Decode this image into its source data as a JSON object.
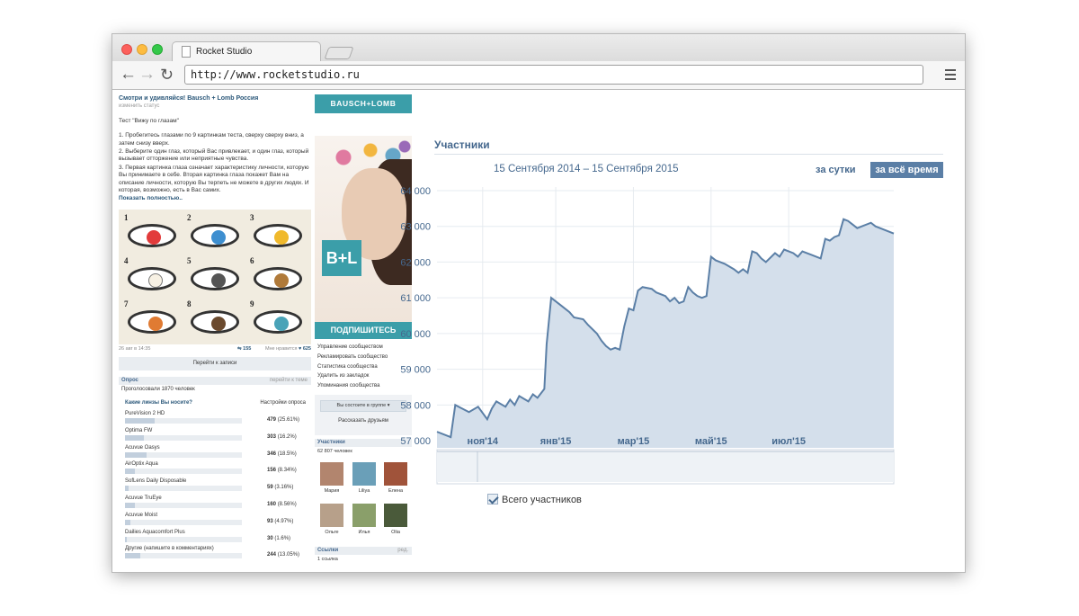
{
  "browser": {
    "tab_title": "Rocket Studio",
    "url": "http://www.rocketstudio.ru"
  },
  "post": {
    "title": "Смотри и удивляйся! Bausch + Lomb Россия",
    "status_link": "изменить статус",
    "lines": [
      "Тест \"Вижу по глазам\"",
      "",
      "1. Пробегитесь глазами по 9 картинкам теста, сверху сверху вниз, а затем снизу вверх.",
      "2. Выберите один глаз, который Вас привлекает, и один глаз, который вызывает отторжение или неприятные чувства.",
      "3. Первая картинка глаза означает характеристику личности, которую Вы принимаете в себе. Вторая картинка глаза покажет Вам на описание личности, которую Вы терпеть не можете в других людях. И которая, возможно, есть в Вас самих."
    ],
    "show_full": "Показать полностью..",
    "eye_numbers": [
      "1",
      "2",
      "3",
      "4",
      "5",
      "6",
      "7",
      "8",
      "9"
    ],
    "date": "26 авг в 14:35",
    "shares": "155",
    "likes_label": "Мне нравится",
    "likes": "625",
    "goto_label": "Перейти к записи"
  },
  "poll": {
    "header": "Опрос",
    "header_link": "перейти к теме",
    "voted": "Проголосовали 1870 человек",
    "question": "Какие линзы Вы носите?",
    "settings": "Настройки опроса",
    "options": [
      {
        "name": "PureVision 2 HD",
        "count": "479",
        "pct": "(25.61%)",
        "frac": 0.2561
      },
      {
        "name": "Optima FW",
        "count": "303",
        "pct": "(16.2%)",
        "frac": 0.162
      },
      {
        "name": "Acuvue Oasys",
        "count": "346",
        "pct": "(18.5%)",
        "frac": 0.185
      },
      {
        "name": "AirOptix Aqua",
        "count": "156",
        "pct": "(8.34%)",
        "frac": 0.0834
      },
      {
        "name": "SofLens Daily Disposable",
        "count": "59",
        "pct": "(3.16%)",
        "frac": 0.0316
      },
      {
        "name": "Acuvue TruEye",
        "count": "160",
        "pct": "(8.56%)",
        "frac": 0.0856
      },
      {
        "name": "Acuvue Moist",
        "count": "93",
        "pct": "(4.97%)",
        "frac": 0.0497
      },
      {
        "name": "Dailies Aquacomfort Plus",
        "count": "30",
        "pct": "(1.6%)",
        "frac": 0.016
      },
      {
        "name": "Другие (напишите в комментариях)",
        "count": "244",
        "pct": "(13.05%)",
        "frac": 0.1305
      }
    ]
  },
  "ad": {
    "brand": "BAUSCH+LOMB",
    "logo": "B+L",
    "subscribe": "ПОДПИШИТЕСЬ"
  },
  "management": [
    "Управление сообществом",
    "Рекламировать сообщество",
    "Статистика сообщества",
    "Удалить из закладок",
    "Упоминания сообщества"
  ],
  "group": {
    "member_btn": "Вы состоите в группе",
    "tell_friends": "Рассказать друзьям"
  },
  "members": {
    "header": "Участники",
    "count": "62 807 человек",
    "people": [
      {
        "name": "Мария",
        "color": "#b2856e"
      },
      {
        "name": "Liliya",
        "color": "#6a9fb8"
      },
      {
        "name": "Елена",
        "color": "#a0533a"
      },
      {
        "name": "Ольге",
        "color": "#b7a08a"
      },
      {
        "name": "Илья",
        "color": "#8a9f6a"
      },
      {
        "name": "Olia",
        "color": "#4a5a3a"
      }
    ]
  },
  "links": {
    "header": "Ссылки",
    "header_link": "ред.",
    "count": "1 ссылка"
  },
  "stats": {
    "title": "Участники",
    "date_range": "15 Сентября 2014 – 15 Сентября 2015",
    "period_day": "за сутки",
    "period_all": "за всё время",
    "legend": "Всего участников"
  },
  "colors": {
    "vk_blue": "#45688e",
    "bl_teal": "#3b9ea9",
    "chart_line": "#5b7fa6",
    "chart_fill": "#d4dfeb"
  },
  "chart_data": {
    "type": "area",
    "title": "Участники",
    "y_ticks": [
      "57 000",
      "58 000",
      "59 000",
      "60 000",
      "61 000",
      "62 000",
      "63 000",
      "64 000"
    ],
    "ylim": [
      56800,
      64100
    ],
    "x_ticks": [
      {
        "label": "ноя'14",
        "pos": 0.1
      },
      {
        "label": "янв'15",
        "pos": 0.26
      },
      {
        "label": "мар'15",
        "pos": 0.43
      },
      {
        "label": "май'15",
        "pos": 0.6
      },
      {
        "label": "июл'15",
        "pos": 0.77
      }
    ],
    "series": [
      {
        "name": "Всего участников",
        "points": [
          [
            0.0,
            57250
          ],
          [
            0.03,
            57100
          ],
          [
            0.04,
            58000
          ],
          [
            0.07,
            57800
          ],
          [
            0.09,
            57950
          ],
          [
            0.11,
            57600
          ],
          [
            0.12,
            57900
          ],
          [
            0.13,
            58100
          ],
          [
            0.15,
            57950
          ],
          [
            0.16,
            58150
          ],
          [
            0.17,
            58000
          ],
          [
            0.18,
            58250
          ],
          [
            0.2,
            58100
          ],
          [
            0.21,
            58300
          ],
          [
            0.22,
            58200
          ],
          [
            0.235,
            58450
          ],
          [
            0.24,
            59700
          ],
          [
            0.25,
            61000
          ],
          [
            0.27,
            60800
          ],
          [
            0.29,
            60600
          ],
          [
            0.3,
            60450
          ],
          [
            0.32,
            60400
          ],
          [
            0.33,
            60250
          ],
          [
            0.35,
            60000
          ],
          [
            0.36,
            59800
          ],
          [
            0.37,
            59650
          ],
          [
            0.38,
            59550
          ],
          [
            0.39,
            59600
          ],
          [
            0.4,
            59550
          ],
          [
            0.41,
            60200
          ],
          [
            0.42,
            60700
          ],
          [
            0.43,
            60650
          ],
          [
            0.44,
            61200
          ],
          [
            0.45,
            61300
          ],
          [
            0.47,
            61250
          ],
          [
            0.48,
            61150
          ],
          [
            0.5,
            61050
          ],
          [
            0.51,
            60900
          ],
          [
            0.52,
            61000
          ],
          [
            0.53,
            60850
          ],
          [
            0.54,
            60900
          ],
          [
            0.55,
            61300
          ],
          [
            0.56,
            61150
          ],
          [
            0.57,
            61050
          ],
          [
            0.58,
            61000
          ],
          [
            0.59,
            61050
          ],
          [
            0.6,
            62150
          ],
          [
            0.61,
            62050
          ],
          [
            0.62,
            62000
          ],
          [
            0.63,
            61950
          ],
          [
            0.65,
            61800
          ],
          [
            0.66,
            61700
          ],
          [
            0.67,
            61800
          ],
          [
            0.68,
            61700
          ],
          [
            0.69,
            62300
          ],
          [
            0.7,
            62250
          ],
          [
            0.71,
            62100
          ],
          [
            0.72,
            62000
          ],
          [
            0.74,
            62250
          ],
          [
            0.75,
            62150
          ],
          [
            0.76,
            62350
          ],
          [
            0.78,
            62250
          ],
          [
            0.79,
            62150
          ],
          [
            0.8,
            62300
          ],
          [
            0.82,
            62200
          ],
          [
            0.84,
            62100
          ],
          [
            0.85,
            62650
          ],
          [
            0.86,
            62600
          ],
          [
            0.87,
            62700
          ],
          [
            0.88,
            62750
          ],
          [
            0.89,
            63200
          ],
          [
            0.9,
            63150
          ],
          [
            0.91,
            63050
          ],
          [
            0.92,
            62950
          ],
          [
            0.93,
            63000
          ],
          [
            0.95,
            63100
          ],
          [
            0.96,
            63000
          ],
          [
            0.97,
            62950
          ],
          [
            0.98,
            62900
          ],
          [
            1.0,
            62800
          ]
        ]
      }
    ],
    "grid": true,
    "legend": "bottom-left"
  }
}
